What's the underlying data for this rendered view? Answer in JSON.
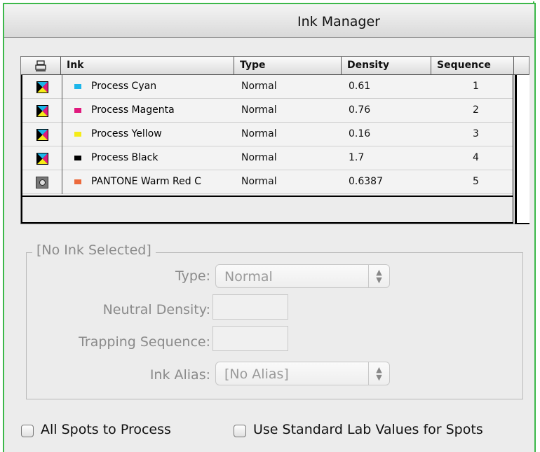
{
  "window": {
    "title": "Ink Manager"
  },
  "table": {
    "headers": {
      "ink": "Ink",
      "type": "Type",
      "density": "Density",
      "sequence": "Sequence"
    },
    "rows": [
      {
        "icon": "process",
        "swatch": "#1cb6ea",
        "name": "Process Cyan",
        "type": "Normal",
        "density": "0.61",
        "sequence": "1"
      },
      {
        "icon": "process",
        "swatch": "#e0197d",
        "name": "Process Magenta",
        "type": "Normal",
        "density": "0.76",
        "sequence": "2"
      },
      {
        "icon": "process",
        "swatch": "#f5ec18",
        "name": "Process Yellow",
        "type": "Normal",
        "density": "0.16",
        "sequence": "3"
      },
      {
        "icon": "process",
        "swatch": "#000000",
        "name": "Process Black",
        "type": "Normal",
        "density": "1.7",
        "sequence": "4"
      },
      {
        "icon": "spot",
        "swatch": "#ec6a3c",
        "name": "PANTONE Warm Red C",
        "type": "Normal",
        "density": "0.6387",
        "sequence": "5"
      }
    ]
  },
  "details": {
    "group_title": "[No Ink Selected]",
    "type_label": "Type:",
    "type_value": "Normal",
    "neutral_density_label": "Neutral Density:",
    "trapping_sequence_label": "Trapping Sequence:",
    "ink_alias_label": "Ink Alias:",
    "ink_alias_value": "[No Alias]"
  },
  "options": {
    "all_spots": "All Spots to Process",
    "standard_lab": "Use Standard Lab Values for Spots"
  }
}
